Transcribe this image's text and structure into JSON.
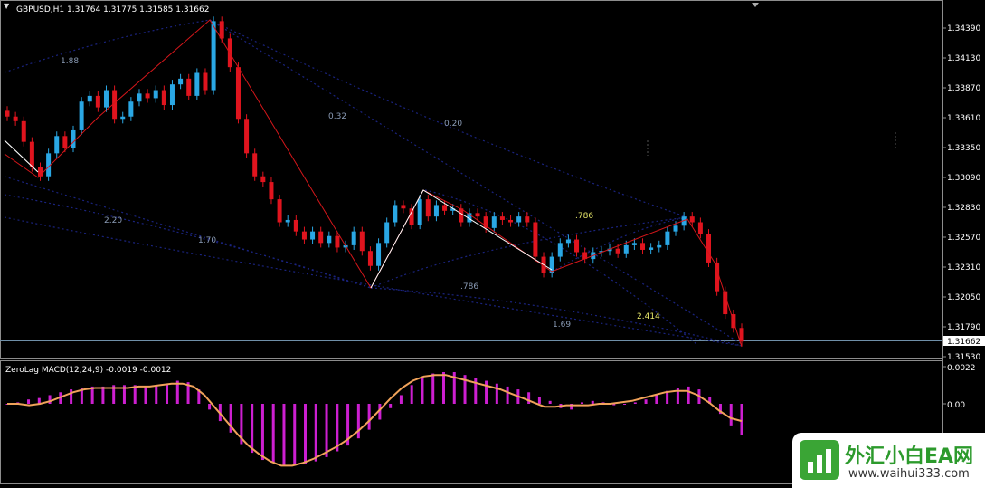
{
  "header": {
    "menu_icon": "triangle-down-icon",
    "symbol_text": "GBPUSD,H1  1.31764 1.31775 1.31585 1.31662"
  },
  "price_axis": {
    "ticks": [
      "1.34390",
      "1.34130",
      "1.33870",
      "1.33610",
      "1.33350",
      "1.33090",
      "1.32830",
      "1.32570",
      "1.32310",
      "1.32050",
      "1.31790",
      "1.31530"
    ],
    "current_price": "1.31662"
  },
  "macd": {
    "title": "ZeroLag MACD(12,24,9) -0.0019 -0.0012",
    "ticks": [
      "0.0022",
      "0.00"
    ]
  },
  "fibo_labels": [
    "1.88",
    "0.32",
    "0.20",
    "2.20",
    "1.70",
    ".786",
    ".786",
    "1.69",
    "2.414"
  ],
  "colors": {
    "bull": "#2aa7e4",
    "bear": "#e0141e",
    "zigzag": "#d4161a",
    "macd_hist": "#cc1fd0",
    "signal": "#f0a25a",
    "fibo": "#1a237e"
  },
  "watermark": {
    "title": "外汇小白EA网",
    "url": "www.waihui333.com",
    "icon": "bar-chart-logo-icon"
  },
  "chart_data": {
    "type": "candlestick",
    "symbol": "GBPUSD",
    "timeframe": "H1",
    "ohlc_last": {
      "open": 1.31764,
      "high": 1.31775,
      "low": 1.31585,
      "close": 1.31662
    },
    "ylim": [
      1.3153,
      1.3456
    ],
    "closes": [
      1.3362,
      1.3358,
      1.334,
      1.3318,
      1.331,
      1.333,
      1.3345,
      1.3335,
      1.335,
      1.3375,
      1.338,
      1.337,
      1.3385,
      1.336,
      1.3362,
      1.3375,
      1.3382,
      1.3378,
      1.3385,
      1.3372,
      1.339,
      1.3395,
      1.338,
      1.34,
      1.3385,
      1.3445,
      1.343,
      1.3405,
      1.336,
      1.333,
      1.331,
      1.3305,
      1.329,
      1.327,
      1.3272,
      1.3262,
      1.3255,
      1.3262,
      1.3252,
      1.3258,
      1.3248,
      1.325,
      1.3262,
      1.3245,
      1.3232,
      1.3252,
      1.327,
      1.3285,
      1.3282,
      1.3268,
      1.329,
      1.3275,
      1.3285,
      1.328,
      1.3282,
      1.327,
      1.3278,
      1.3275,
      1.3265,
      1.3275,
      1.3272,
      1.327,
      1.3275,
      1.327,
      1.324,
      1.3226,
      1.324,
      1.3252,
      1.3255,
      1.3244,
      1.3238,
      1.3244,
      1.3245,
      1.3247,
      1.3243,
      1.325,
      1.3252,
      1.3246,
      1.3248,
      1.325,
      1.3262,
      1.3267,
      1.3275,
      1.327,
      1.326,
      1.3235,
      1.321,
      1.319,
      1.3178,
      1.31662
    ],
    "macd_hist": [
      0.0,
      0.0001,
      0.0003,
      0.0004,
      0.0006,
      0.0008,
      0.001,
      0.0011,
      0.0012,
      0.0012,
      0.0013,
      0.0013,
      0.0013,
      0.0012,
      0.0013,
      0.0014,
      0.0016,
      0.0015,
      0.001,
      -0.0004,
      -0.0012,
      -0.002,
      -0.0028,
      -0.0034,
      -0.0039,
      -0.0041,
      -0.0043,
      -0.0043,
      -0.0042,
      -0.004,
      -0.0037,
      -0.0033,
      -0.0029,
      -0.0024,
      -0.0018,
      -0.0011,
      -0.0003,
      0.0006,
      0.0013,
      0.0018,
      0.0021,
      0.0022,
      0.0022,
      0.002,
      0.0018,
      0.0016,
      0.0014,
      0.0012,
      0.001,
      0.0008,
      0.0005,
      0.0002,
      -0.0003,
      -0.0004,
      0.0001,
      0.0002,
      0.0001,
      -0.0001,
      0.0,
      0.0001,
      0.0003,
      0.0006,
      0.0009,
      0.0011,
      0.0012,
      0.001,
      0.0005,
      -0.0007,
      -0.0015,
      -0.0022
    ],
    "macd_signal": [
      0.0,
      0.0,
      -0.0001,
      0.0,
      0.0002,
      0.0005,
      0.0008,
      0.001,
      0.0011,
      0.0011,
      0.0011,
      0.0011,
      0.0012,
      0.0012,
      0.0013,
      0.0014,
      0.0014,
      0.0012,
      0.0006,
      -0.0003,
      -0.0012,
      -0.0021,
      -0.0029,
      -0.0035,
      -0.004,
      -0.0043,
      -0.0043,
      -0.0041,
      -0.0038,
      -0.0034,
      -0.003,
      -0.0025,
      -0.0019,
      -0.0012,
      -0.0004,
      0.0004,
      0.0011,
      0.0016,
      0.0019,
      0.002,
      0.002,
      0.0018,
      0.0016,
      0.0014,
      0.0012,
      0.001,
      0.0007,
      0.0004,
      0.0001,
      -0.0002,
      -0.0002,
      -0.0001,
      -0.0001,
      -0.0001,
      0.0,
      0.0,
      0.0001,
      0.0002,
      0.0004,
      0.0006,
      0.0008,
      0.0009,
      0.0009,
      0.0006,
      0.0001,
      -0.0005,
      -0.001,
      -0.0012
    ]
  }
}
